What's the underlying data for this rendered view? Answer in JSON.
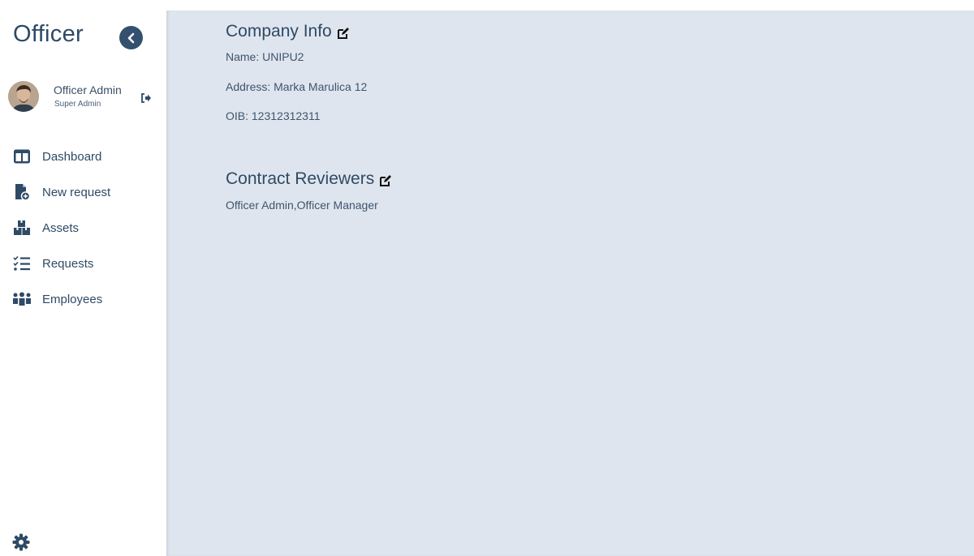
{
  "sidebar": {
    "brand": "Officer",
    "user": {
      "name": "Officer Admin",
      "role": "Super Admin"
    },
    "nav": [
      {
        "label": "Dashboard",
        "icon": "dashboard-icon"
      },
      {
        "label": "New request",
        "icon": "new-request-icon"
      },
      {
        "label": "Assets",
        "icon": "assets-icon"
      },
      {
        "label": "Requests",
        "icon": "requests-icon"
      },
      {
        "label": "Employees",
        "icon": "employees-icon"
      }
    ]
  },
  "main": {
    "company_info": {
      "title": "Company Info",
      "name_line": "Name: UNIPU2",
      "address_line": "Address: Marka Marulica 12",
      "oib_line": "OIB: 12312312311"
    },
    "contract_reviewers": {
      "title": "Contract Reviewers",
      "reviewers_line": "Officer Admin,Officer Manager"
    }
  },
  "colors": {
    "primary": "#2e4a66",
    "main_background": "#dfe5ee",
    "sidebar_background": "#ffffff"
  }
}
